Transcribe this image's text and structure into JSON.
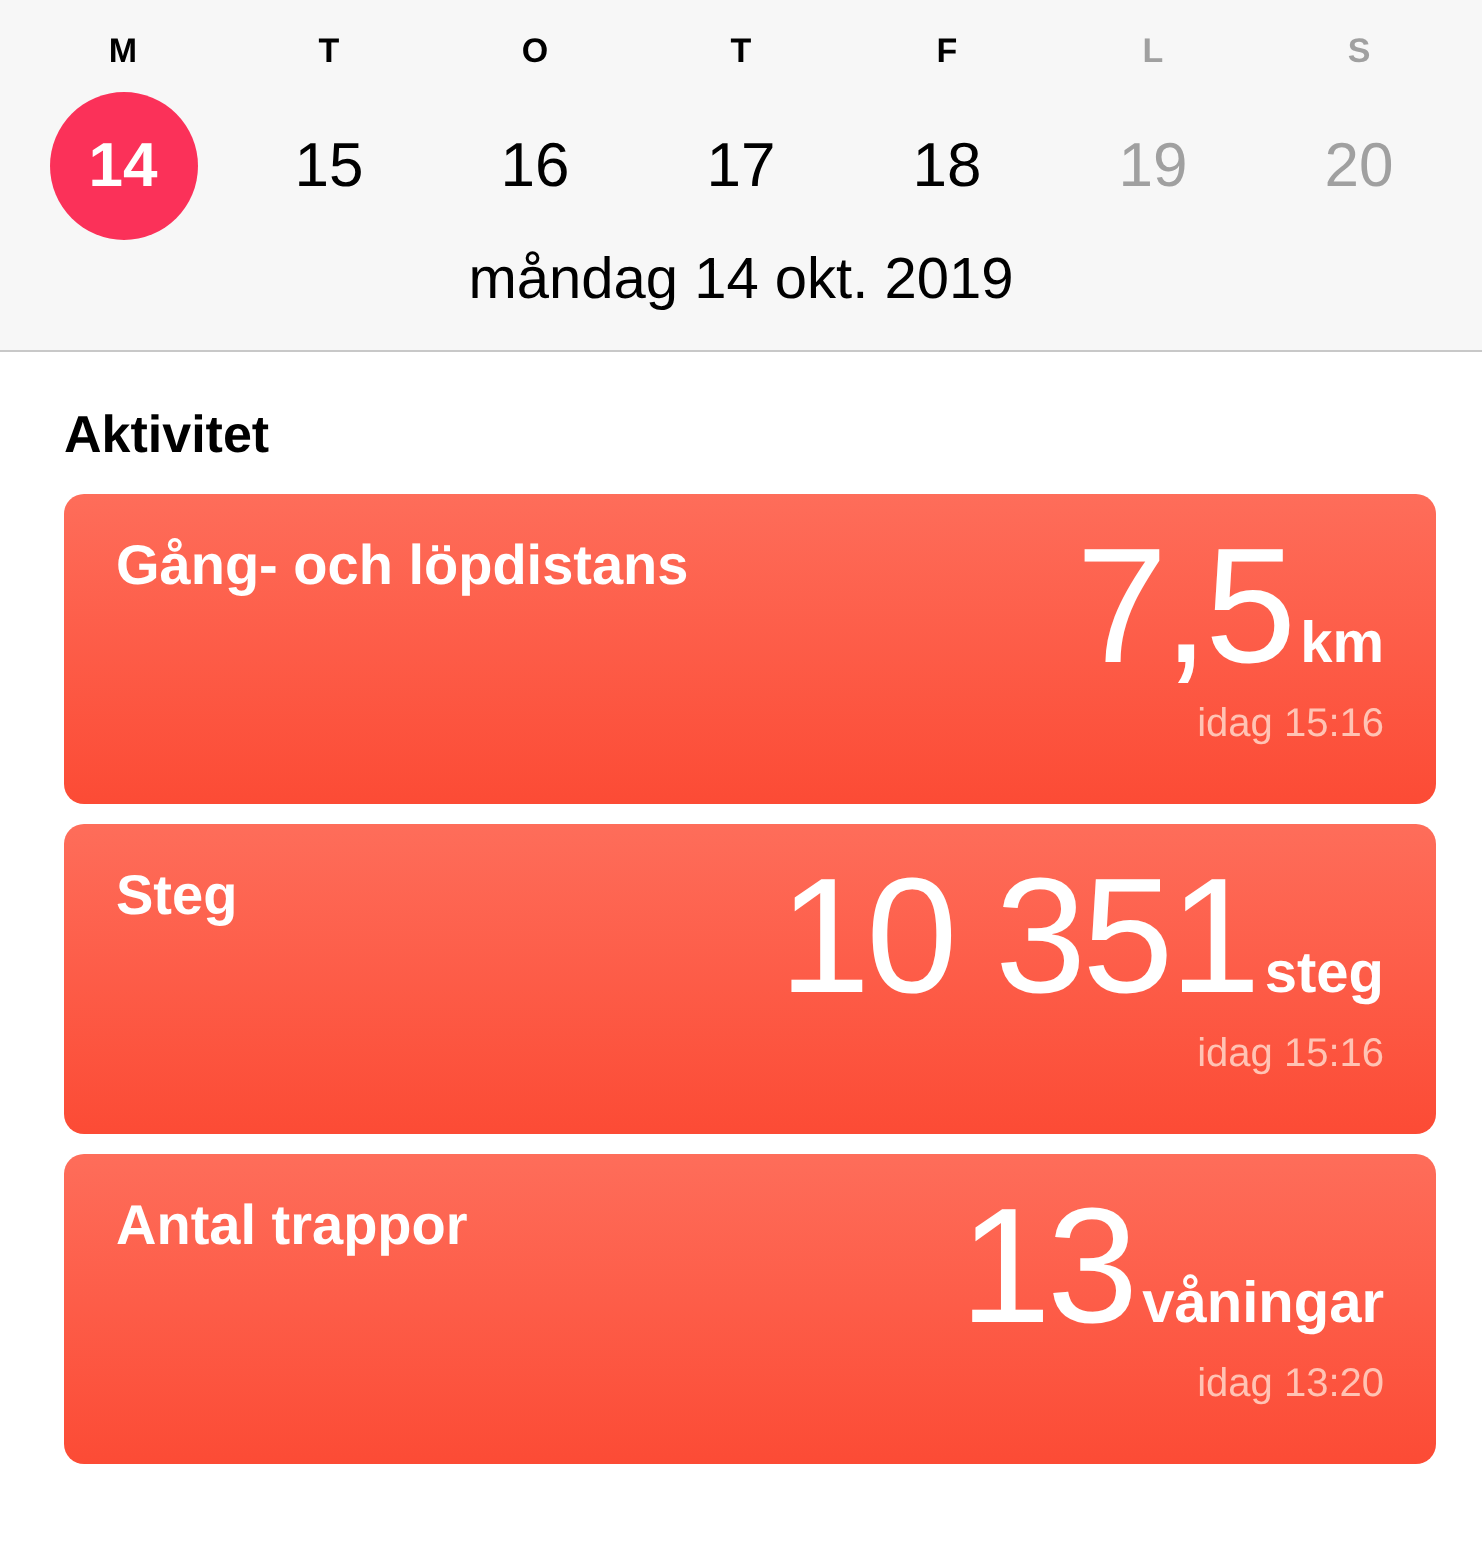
{
  "week": {
    "days": [
      {
        "letter": "M",
        "date": "14",
        "selected": true,
        "dimmed": false
      },
      {
        "letter": "T",
        "date": "15",
        "selected": false,
        "dimmed": false
      },
      {
        "letter": "O",
        "date": "16",
        "selected": false,
        "dimmed": false
      },
      {
        "letter": "T",
        "date": "17",
        "selected": false,
        "dimmed": false
      },
      {
        "letter": "F",
        "date": "18",
        "selected": false,
        "dimmed": false
      },
      {
        "letter": "L",
        "date": "19",
        "selected": false,
        "dimmed": true
      },
      {
        "letter": "S",
        "date": "20",
        "selected": false,
        "dimmed": true
      }
    ],
    "full_date": "måndag 14 okt. 2019"
  },
  "section": {
    "title": "Aktivitet",
    "cards": [
      {
        "title": "Gång- och löpdistans",
        "value": "7,5",
        "unit": "km",
        "time": "idag 15:16"
      },
      {
        "title": "Steg",
        "value": "10 351",
        "unit": "steg",
        "time": "idag 15:16"
      },
      {
        "title": "Antal trappor",
        "value": "13",
        "unit": "våningar",
        "time": "idag 13:20"
      }
    ]
  }
}
